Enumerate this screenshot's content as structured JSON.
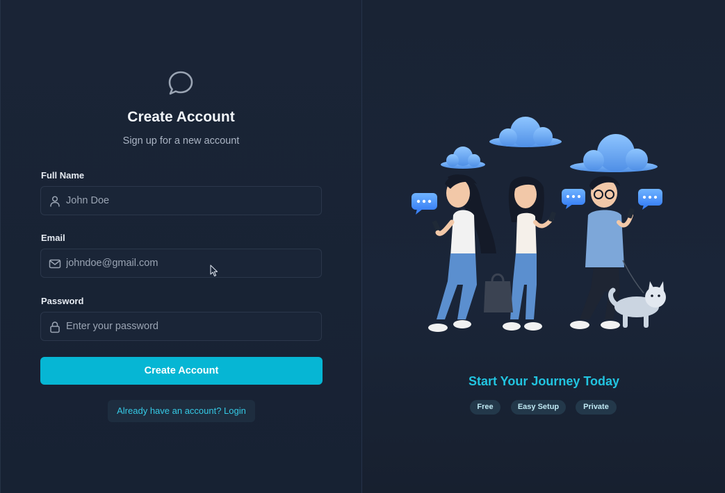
{
  "form": {
    "title": "Create Account",
    "subtitle": "Sign up for a new account",
    "fields": {
      "full_name": {
        "label": "Full Name",
        "placeholder": "John Doe",
        "icon": "user-icon"
      },
      "email": {
        "label": "Email",
        "placeholder": "johndoe@gmail.com",
        "icon": "mail-icon"
      },
      "password": {
        "label": "Password",
        "placeholder": "Enter your password",
        "icon": "lock-icon"
      }
    },
    "submit_label": "Create Account",
    "login_link": "Already have an account? Login",
    "logo_icon": "chat-bubble-icon"
  },
  "promo": {
    "title": "Start Your Journey Today",
    "badges": [
      "Free",
      "Easy Setup",
      "Private"
    ]
  },
  "colors": {
    "accent": "#06b6d4",
    "accent_text": "#22c4e0",
    "background": "#172131"
  }
}
